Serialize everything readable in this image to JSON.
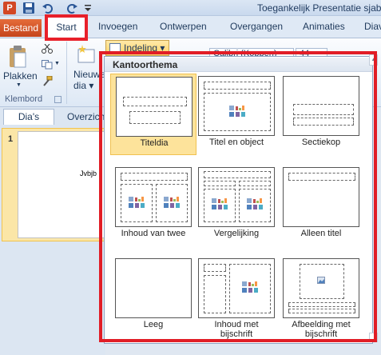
{
  "app": {
    "title": "Toegankelijk Presentatie sjabl",
    "icon_letter": "P"
  },
  "tabs": {
    "file": "Bestand",
    "start": "Start",
    "invoegen": "Invoegen",
    "ontwerpen": "Ontwerpen",
    "overgangen": "Overgangen",
    "animaties": "Animaties",
    "diav": "Diav"
  },
  "ribbon": {
    "paste_label": "Plakken",
    "clipboard_group": "Klembord",
    "new_slide_label_1": "Nieuwe",
    "new_slide_label_2": "dia",
    "layout_button": "Indeling",
    "font_name": "Calibri (Koppen)",
    "font_size": "44"
  },
  "pane": {
    "tab_slides": "Dia's",
    "tab_outline": "Overzicht",
    "slide_number": "1",
    "slide_text": "Jvbjb"
  },
  "gallery": {
    "header": "Kantoorthema",
    "layouts": [
      {
        "label_1": "Titeldia",
        "label_2": ""
      },
      {
        "label_1": "Titel en object",
        "label_2": ""
      },
      {
        "label_1": "Sectiekop",
        "label_2": ""
      },
      {
        "label_1": "Inhoud van twee",
        "label_2": ""
      },
      {
        "label_1": "Vergelijking",
        "label_2": ""
      },
      {
        "label_1": "Alleen titel",
        "label_2": ""
      },
      {
        "label_1": "Leeg",
        "label_2": ""
      },
      {
        "label_1": "Inhoud met",
        "label_2": "bijschrift"
      },
      {
        "label_1": "Afbeelding met",
        "label_2": "bijschrift"
      }
    ],
    "selected_index": 0
  },
  "colors": {
    "highlight_red": "#e11d26",
    "file_tab": "#d24726",
    "selected": "#fde39b"
  }
}
